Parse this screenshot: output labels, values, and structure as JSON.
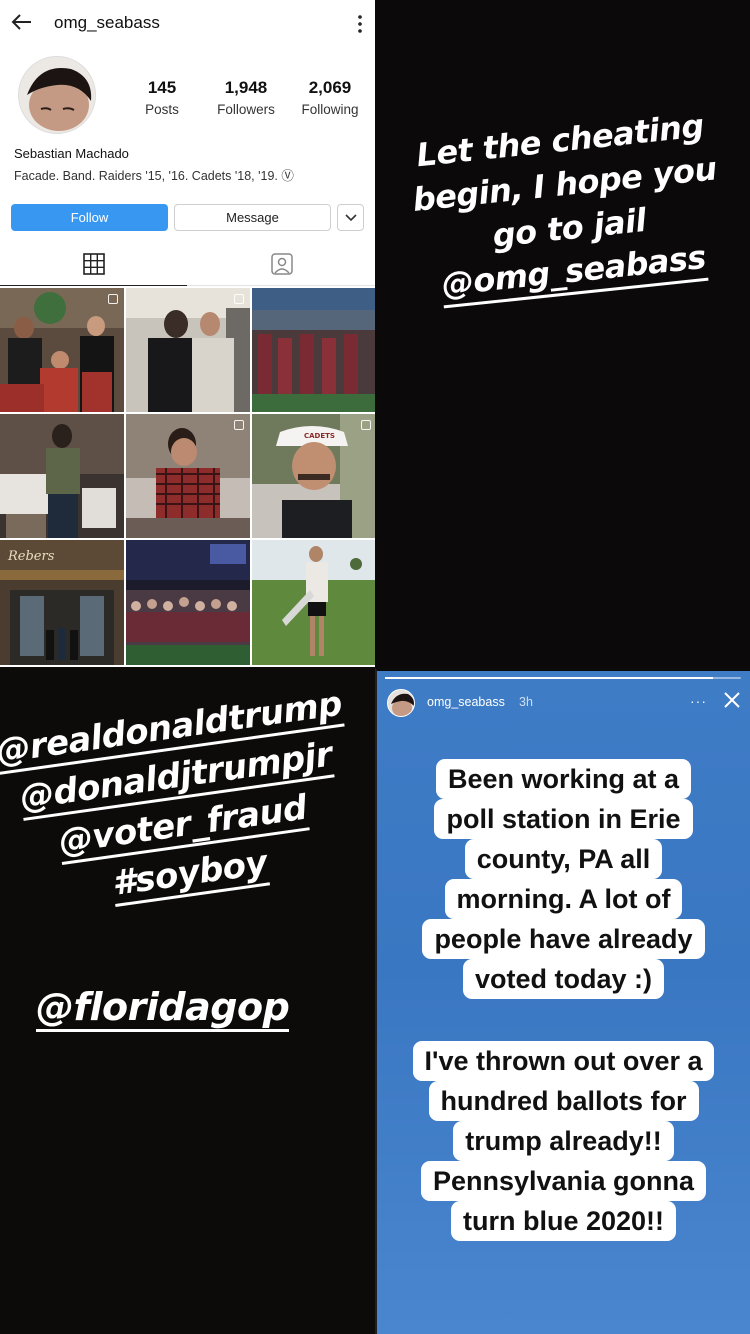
{
  "profile": {
    "username": "omg_seabass",
    "stats": [
      {
        "value": "145",
        "label": "Posts"
      },
      {
        "value": "1,948",
        "label": "Followers"
      },
      {
        "value": "2,069",
        "label": "Following"
      }
    ],
    "full_name": "Sebastian Machado",
    "bio": "Facade. Band. Raiders '15, '16. Cadets '18, '19. Ⓥ",
    "follow_label": "Follow",
    "message_label": "Message",
    "accent": "#3897f0",
    "grid_icons": [
      "grid-icon",
      "tagged-icon"
    ],
    "photo_cap_text": "CADETS"
  },
  "story_cheating": {
    "lines": [
      "Let the cheating",
      "begin, I hope you",
      "go to jail"
    ],
    "mention": "@omg_seabass"
  },
  "story_tags": {
    "tags": [
      "@realdonaldtrump",
      "@donaldjtrumpjr",
      "@voter_fraud",
      "#soyboy"
    ],
    "gop": "@floridagop"
  },
  "story_original": {
    "username": "omg_seabass",
    "time": "3h",
    "menu": "···",
    "progress": 0.92,
    "paragraph1": [
      "Been working at a",
      "poll station in Erie",
      "county, PA all",
      "morning. A lot of",
      "people have already",
      "voted today :)"
    ],
    "paragraph2": [
      "I've thrown out over a",
      "hundred ballots for",
      "trump already!!",
      "Pennsylvania gonna",
      "turn blue 2020!!"
    ],
    "background": "#3f7cc6"
  }
}
